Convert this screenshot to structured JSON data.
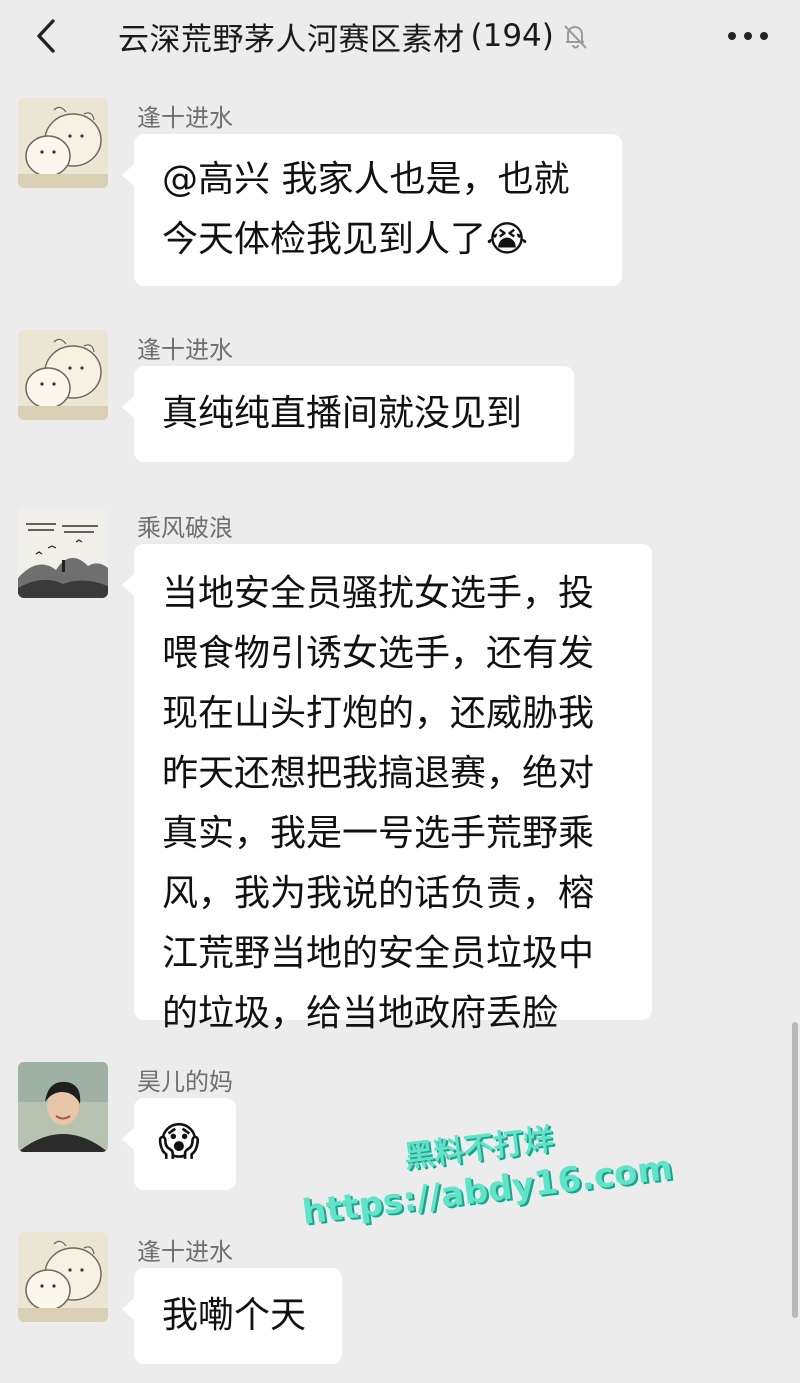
{
  "header": {
    "back_icon": "chevron-left-icon",
    "title": "云深荒野茅人河赛区素材",
    "count": "(194)",
    "mute_icon": "bell-muted-icon",
    "more_icon": "more-dots-icon"
  },
  "messages": [
    {
      "sender": "逢十进水",
      "lines": [
        "@高兴 我家人也是，也就",
        "今天体检我见到人了"
      ],
      "emoji": "😭"
    },
    {
      "sender": "逢十进水",
      "lines": [
        "真纯纯直播间就没见到"
      ]
    },
    {
      "sender": "乘风破浪",
      "lines": [
        "当地安全员骚扰女选手，投",
        "喂食物引诱女选手，还有发",
        "现在山头打炮的，还威胁我",
        "昨天还想把我搞退赛，绝对",
        "真实，我是一号选手荒野乘",
        "风，我为我说的话负责，榕",
        "江荒野当地的安全员垃圾中",
        "的垃圾，给当地政府丢脸"
      ]
    },
    {
      "sender": "昊儿的妈",
      "emoji": "😱"
    },
    {
      "sender": "逢十进水",
      "lines": [
        "我嘞个天"
      ]
    }
  ],
  "watermark": {
    "line1": "黑料不打烊",
    "line2": "https://abdy16.com"
  }
}
